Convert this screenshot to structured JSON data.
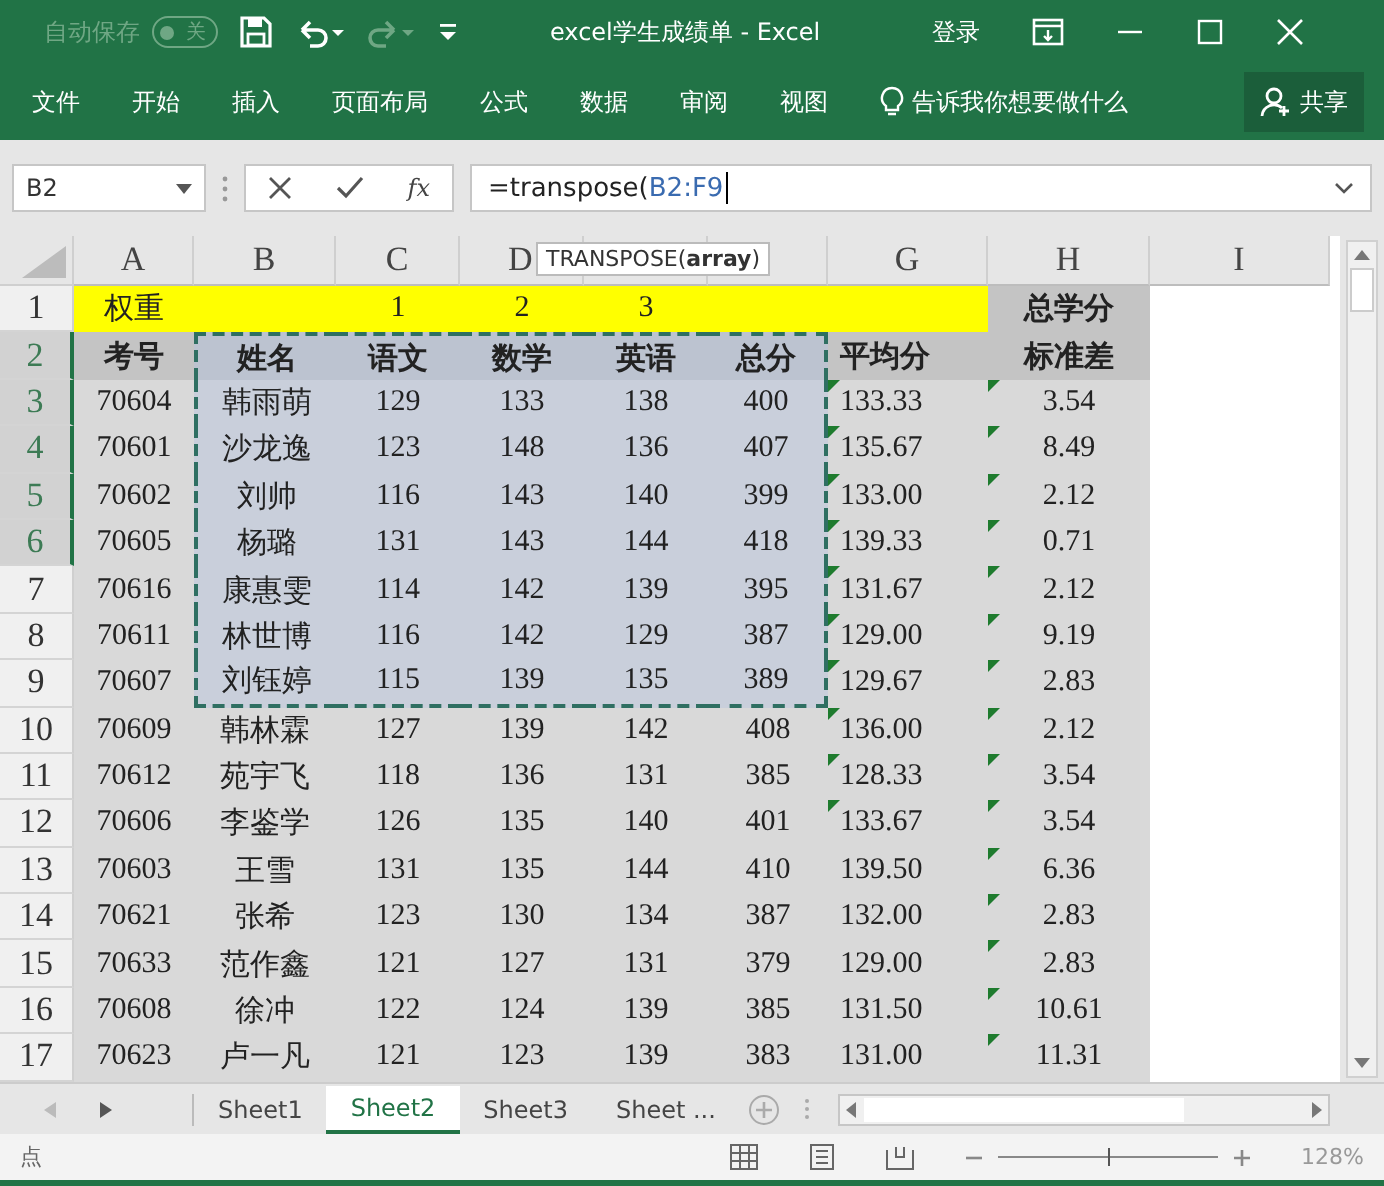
{
  "title_bar": {
    "autosave_label": "自动保存",
    "autosave_on": false,
    "autosave_state": "关",
    "title": "excel学生成绩单  -  Excel",
    "sign_in": "登录"
  },
  "ribbon": {
    "tabs": [
      "文件",
      "开始",
      "插入",
      "页面布局",
      "公式",
      "数据",
      "审阅",
      "视图"
    ],
    "tell_me": "告诉我你想要做什么",
    "share": "共享"
  },
  "formula_bar": {
    "name_box": "B2",
    "function_label": "fx",
    "formula": "=transpose(",
    "reference": "B2:F9"
  },
  "tooltip": "TRANSPOSE(**array**)",
  "grid": {
    "columns": [
      {
        "label": "A"
      },
      {
        "label": "B"
      },
      {
        "label": "C"
      },
      {
        "label": "D"
      },
      {},
      {},
      {
        "label": "G"
      },
      {
        "label": "H"
      },
      {
        "label": "I"
      }
    ],
    "rows": [
      {
        "num": "1",
        "highlighted": false,
        "kind": "weights",
        "cells": [
          {
            "text": "权重",
            "color": "#ffff00"
          },
          {
            "color": "#ffff00"
          },
          {
            "text": "1",
            "color": "#ffff00"
          },
          {
            "text": "2",
            "color": "#ffff00"
          },
          {
            "text": "3",
            "color": "#ffff00"
          },
          {
            "color": "#ffff00"
          },
          {
            "color": "#ffff00"
          },
          {
            "text": "总学分",
            "color": "#c4c4c4",
            "bold": true
          }
        ]
      },
      {
        "num": "2",
        "highlighted": true,
        "kind": "header",
        "cells": [
          {
            "text": "考号"
          },
          {
            "text": "姓名",
            "in_range": true
          },
          {
            "text": "语文",
            "in_range": true
          },
          {
            "text": "数学",
            "in_range": true
          },
          {
            "text": "英语",
            "in_range": true
          },
          {
            "text": "总分",
            "in_range": true
          },
          {
            "text": "平均分"
          },
          {
            "text": "标准差"
          }
        ]
      },
      {
        "num": "3",
        "highlighted": true,
        "kind": "data",
        "cells": [
          {
            "text": "70604"
          },
          {
            "text": "韩雨萌",
            "in_range": true
          },
          {
            "text": "129",
            "in_range": true
          },
          {
            "text": "133",
            "in_range": true
          },
          {
            "text": "138",
            "in_range": true
          },
          {
            "text": "400",
            "in_range": true
          },
          {
            "text": "133.33",
            "flag": true
          },
          {
            "text": "3.54",
            "flag": true
          }
        ]
      },
      {
        "num": "4",
        "highlighted": true,
        "kind": "data",
        "cells": [
          {
            "text": "70601"
          },
          {
            "text": "沙龙逸",
            "in_range": true
          },
          {
            "text": "123",
            "in_range": true
          },
          {
            "text": "148",
            "in_range": true
          },
          {
            "text": "136",
            "in_range": true
          },
          {
            "text": "407",
            "in_range": true
          },
          {
            "text": "135.67",
            "flag": true
          },
          {
            "text": "8.49",
            "flag": true
          }
        ]
      },
      {
        "num": "5",
        "highlighted": true,
        "kind": "data",
        "cells": [
          {
            "text": "70602"
          },
          {
            "text": "刘帅",
            "in_range": true
          },
          {
            "text": "116",
            "in_range": true
          },
          {
            "text": "143",
            "in_range": true
          },
          {
            "text": "140",
            "in_range": true
          },
          {
            "text": "399",
            "in_range": true
          },
          {
            "text": "133.00",
            "flag": true
          },
          {
            "text": "2.12",
            "flag": true
          }
        ]
      },
      {
        "num": "6",
        "highlighted": true,
        "kind": "data",
        "cells": [
          {
            "text": "70605"
          },
          {
            "text": "杨璐",
            "in_range": true
          },
          {
            "text": "131",
            "in_range": true
          },
          {
            "text": "143",
            "in_range": true
          },
          {
            "text": "144",
            "in_range": true
          },
          {
            "text": "418",
            "in_range": true
          },
          {
            "text": "139.33",
            "flag": true
          },
          {
            "text": "0.71",
            "flag": true
          }
        ]
      },
      {
        "num": "7",
        "highlighted": false,
        "kind": "data",
        "cells": [
          {
            "text": "70616"
          },
          {
            "text": "康惠雯",
            "in_range": true
          },
          {
            "text": "114",
            "in_range": true
          },
          {
            "text": "142",
            "in_range": true
          },
          {
            "text": "139",
            "in_range": true
          },
          {
            "text": "395",
            "in_range": true
          },
          {
            "text": "131.67",
            "flag": true
          },
          {
            "text": "2.12",
            "flag": true
          }
        ]
      },
      {
        "num": "8",
        "highlighted": false,
        "kind": "data",
        "cells": [
          {
            "text": "70611"
          },
          {
            "text": "林世博",
            "in_range": true
          },
          {
            "text": "116",
            "in_range": true
          },
          {
            "text": "142",
            "in_range": true
          },
          {
            "text": "129",
            "in_range": true
          },
          {
            "text": "387",
            "in_range": true
          },
          {
            "text": "129.00",
            "flag": true
          },
          {
            "text": "9.19",
            "flag": true
          }
        ]
      },
      {
        "num": "9",
        "highlighted": false,
        "kind": "data",
        "cells": [
          {
            "text": "70607"
          },
          {
            "text": "刘钰婷",
            "in_range": true
          },
          {
            "text": "115",
            "in_range": true
          },
          {
            "text": "139",
            "in_range": true
          },
          {
            "text": "135",
            "in_range": true
          },
          {
            "text": "389",
            "in_range": true
          },
          {
            "text": "129.67",
            "flag": true
          },
          {
            "text": "2.83",
            "flag": true
          }
        ]
      },
      {
        "num": "10",
        "highlighted": false,
        "kind": "data",
        "cells": [
          {
            "text": "70609"
          },
          {
            "text": "韩林霖"
          },
          {
            "text": "127"
          },
          {
            "text": "139"
          },
          {
            "text": "142"
          },
          {
            "text": "408"
          },
          {
            "text": "136.00",
            "flag": true
          },
          {
            "text": "2.12",
            "flag": true
          }
        ]
      },
      {
        "num": "11",
        "highlighted": false,
        "kind": "data",
        "cells": [
          {
            "text": "70612"
          },
          {
            "text": "苑宇飞"
          },
          {
            "text": "118"
          },
          {
            "text": "136"
          },
          {
            "text": "131"
          },
          {
            "text": "385"
          },
          {
            "text": "128.33",
            "flag": true
          },
          {
            "text": "3.54",
            "flag": true
          }
        ]
      },
      {
        "num": "12",
        "highlighted": false,
        "kind": "data",
        "cells": [
          {
            "text": "70606"
          },
          {
            "text": "李鉴学"
          },
          {
            "text": "126"
          },
          {
            "text": "135"
          },
          {
            "text": "140"
          },
          {
            "text": "401"
          },
          {
            "text": "133.67",
            "flag": true
          },
          {
            "text": "3.54",
            "flag": true
          }
        ]
      },
      {
        "num": "13",
        "highlighted": false,
        "kind": "data",
        "cells": [
          {
            "text": "70603"
          },
          {
            "text": "王雪"
          },
          {
            "text": "131"
          },
          {
            "text": "135"
          },
          {
            "text": "144"
          },
          {
            "text": "410"
          },
          {
            "text": "139.50",
            "flag": false
          },
          {
            "text": "6.36",
            "flag": true
          }
        ]
      },
      {
        "num": "14",
        "highlighted": false,
        "kind": "data",
        "cells": [
          {
            "text": "70621"
          },
          {
            "text": "张希"
          },
          {
            "text": "123"
          },
          {
            "text": "130"
          },
          {
            "text": "134"
          },
          {
            "text": "387"
          },
          {
            "text": "132.00",
            "flag": false
          },
          {
            "text": "2.83",
            "flag": true
          }
        ]
      },
      {
        "num": "15",
        "highlighted": false,
        "kind": "data",
        "cells": [
          {
            "text": "70633"
          },
          {
            "text": "范作鑫"
          },
          {
            "text": "121"
          },
          {
            "text": "127"
          },
          {
            "text": "131"
          },
          {
            "text": "379"
          },
          {
            "text": "129.00",
            "flag": false
          },
          {
            "text": "2.83",
            "flag": true
          }
        ]
      },
      {
        "num": "16",
        "highlighted": false,
        "kind": "data",
        "cells": [
          {
            "text": "70608"
          },
          {
            "text": "徐冲"
          },
          {
            "text": "122"
          },
          {
            "text": "124"
          },
          {
            "text": "139"
          },
          {
            "text": "385"
          },
          {
            "text": "131.50",
            "flag": false
          },
          {
            "text": "10.61",
            "flag": true
          }
        ]
      },
      {
        "num": "17",
        "highlighted": false,
        "kind": "data",
        "cells": [
          {
            "text": "70623"
          },
          {
            "text": "卢一凡"
          },
          {
            "text": "121"
          },
          {
            "text": "123"
          },
          {
            "text": "139"
          },
          {
            "text": "383"
          },
          {
            "text": "131.00",
            "flag": false
          },
          {
            "text": "11.31",
            "flag": true
          }
        ]
      }
    ]
  },
  "sheet_tabs": [
    {
      "label": "Sheet1",
      "selected": false
    },
    {
      "label": "Sheet2",
      "selected": true
    },
    {
      "label": "Sheet3",
      "selected": false
    },
    {
      "label": "Sheet ...",
      "selected": false
    }
  ],
  "status_bar": {
    "mode": "点",
    "level": 0.5,
    "zoom": "128%"
  }
}
